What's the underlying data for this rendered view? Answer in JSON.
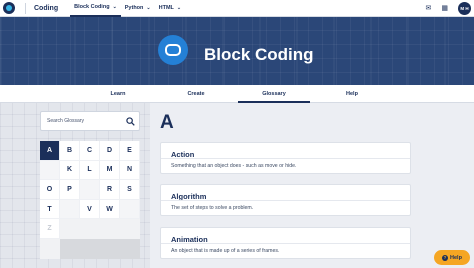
{
  "topbar": {
    "brand": "Coding",
    "tabs": [
      {
        "label": "Block Coding",
        "active": true
      },
      {
        "label": "Python",
        "active": false
      },
      {
        "label": "HTML",
        "active": false
      }
    ],
    "avatar_initials": "M H"
  },
  "hero": {
    "title": "Block Coding"
  },
  "subnav": {
    "tabs": [
      {
        "label": "Learn"
      },
      {
        "label": "Create"
      },
      {
        "label": "Glossary",
        "active": true
      },
      {
        "label": "Help"
      }
    ]
  },
  "search": {
    "placeholder": "Search Glossary"
  },
  "letters": [
    "A",
    "B",
    "C",
    "D",
    "E",
    "",
    "K",
    "L",
    "M",
    "N",
    "O",
    "P",
    "",
    "R",
    "S",
    "T",
    "",
    "V",
    "W",
    "",
    "Z"
  ],
  "section_letter": "A",
  "entries": [
    {
      "term": "Action",
      "definition": "Something that an object does - such as move or hide."
    },
    {
      "term": "Algorithm",
      "definition": "The set of steps to solve a problem."
    },
    {
      "term": "Animation",
      "definition": "An object that is made up of a series of frames."
    }
  ],
  "help_label": "Help",
  "colors": {
    "navy": "#1b2f5a",
    "hero": "#2b4778",
    "accent": "#2480d6",
    "help": "#f5a623"
  }
}
